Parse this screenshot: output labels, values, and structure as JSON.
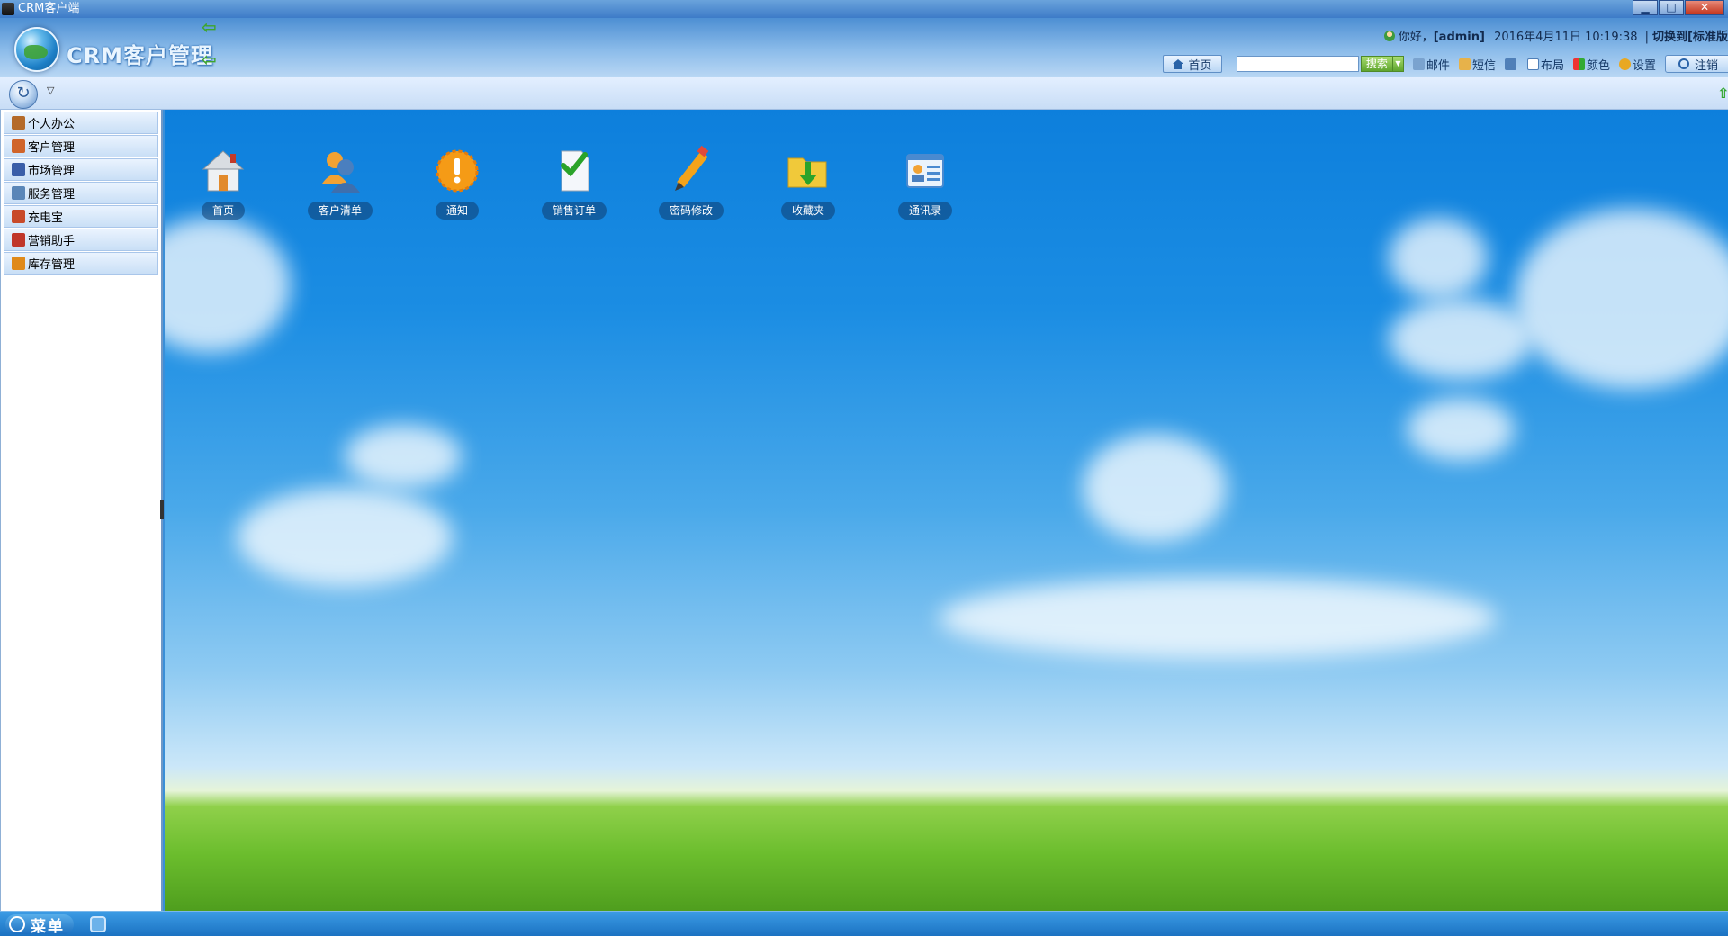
{
  "window": {
    "title": "CRM客户端",
    "controls": {
      "minimize": "▁",
      "maximize": "□",
      "close": "✕"
    }
  },
  "header": {
    "logo_text": "CRM客户管理",
    "greeting": {
      "hello": "你好，",
      "user": "[admin]",
      "datetime": "2016年4月11日 10:19:38",
      "separator": "|",
      "switch_text": "切换到[标准版"
    },
    "toolbar": {
      "home_label": "首页",
      "search_placeholder": "",
      "search_button": "搜索",
      "mail_label": "邮件",
      "sms_label": "短信",
      "layout_label": "布局",
      "color_label": "颜色",
      "settings_label": "设置",
      "logout_label": "注销"
    }
  },
  "sidebar": {
    "items": [
      {
        "label": "个人办公",
        "icon": "pen-person-icon",
        "color": "#b46a2a"
      },
      {
        "label": "客户管理",
        "icon": "customers-icon",
        "color": "#d0642a"
      },
      {
        "label": "市场管理",
        "icon": "book-icon",
        "color": "#3a5ea8"
      },
      {
        "label": "服务管理",
        "icon": "service-icon",
        "color": "#5a86b8"
      },
      {
        "label": "充电宝",
        "icon": "people-icon",
        "color": "#c84a2a"
      },
      {
        "label": "营销助手",
        "icon": "tools-icon",
        "color": "#c0362a"
      },
      {
        "label": "库存管理",
        "icon": "house-icon",
        "color": "#e08a1a"
      }
    ]
  },
  "desktop": {
    "icons": [
      {
        "label": "首页",
        "icon": "home-icon"
      },
      {
        "label": "客户清单",
        "icon": "customer-list-icon"
      },
      {
        "label": "通知",
        "icon": "notice-icon"
      },
      {
        "label": "销售订单",
        "icon": "sales-order-icon"
      },
      {
        "label": "密码修改",
        "icon": "change-password-icon"
      },
      {
        "label": "收藏夹",
        "icon": "favorites-folder-icon"
      },
      {
        "label": "通讯录",
        "icon": "address-book-icon"
      }
    ]
  },
  "taskbar": {
    "menu_label": "菜单"
  }
}
